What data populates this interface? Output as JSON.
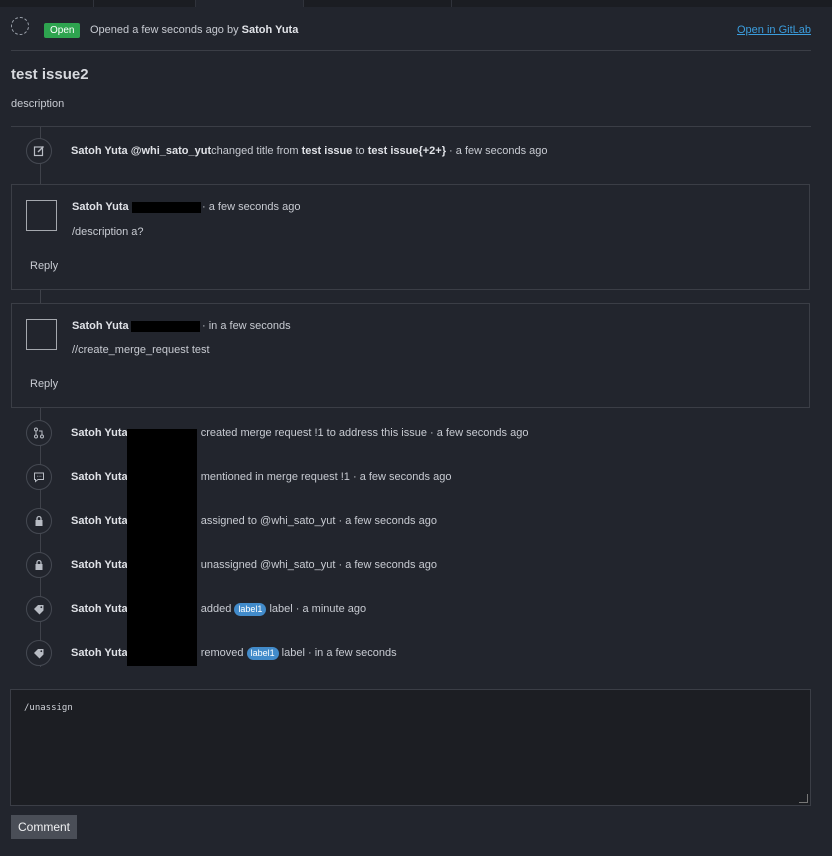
{
  "header": {
    "status": "Open",
    "opened_prefix": "Opened a few seconds ago by",
    "author": "Satoh Yuta",
    "open_in_gitlab": "Open in GitLab"
  },
  "issue": {
    "title": "test issue2",
    "description": "description"
  },
  "timeline": {
    "title_change": {
      "name": "Satoh Yuta",
      "handle": "@whi_sato_yut",
      "action": "changed title from",
      "old_title": "test issue",
      "to": "to",
      "new_title": "test issue{+2+}",
      "time": "· a few seconds ago"
    },
    "comments": [
      {
        "name": "Satoh Yuta",
        "time": "· a few seconds ago",
        "body": "/description a?",
        "reply": "Reply"
      },
      {
        "name": "Satoh Yuta",
        "time": "· in a few seconds",
        "body": "//create_merge_request test",
        "reply": "Reply"
      }
    ],
    "events": [
      {
        "icon": "merge-request-icon",
        "name": "Satoh Yuta",
        "action": "created merge request !1 to address this issue",
        "time": "· a few seconds ago"
      },
      {
        "icon": "comment-icon",
        "name": "Satoh Yuta",
        "action": "mentioned in merge request !1",
        "time": "· a few seconds ago"
      },
      {
        "icon": "user-icon",
        "name": "Satoh Yuta",
        "action": "assigned to @whi_sato_yut",
        "time": "· a few seconds ago"
      },
      {
        "icon": "user-icon",
        "name": "Satoh Yuta",
        "action": "unassigned @whi_sato_yut",
        "time": "· a few seconds ago"
      },
      {
        "icon": "tag-icon",
        "name": "Satoh Yuta",
        "action": "added",
        "label": "label1",
        "suffix": "label",
        "time": "· a minute ago"
      },
      {
        "icon": "tag-icon",
        "name": "Satoh Yuta",
        "action": "removed",
        "label": "label1",
        "suffix": "label",
        "time": "· in a few seconds"
      }
    ]
  },
  "comment_form": {
    "value": "/unassign",
    "submit": "Comment"
  },
  "colors": {
    "background": "#22252d",
    "open_badge": "#2ea44f",
    "link": "#3b9ddd",
    "label": "#428bca"
  }
}
